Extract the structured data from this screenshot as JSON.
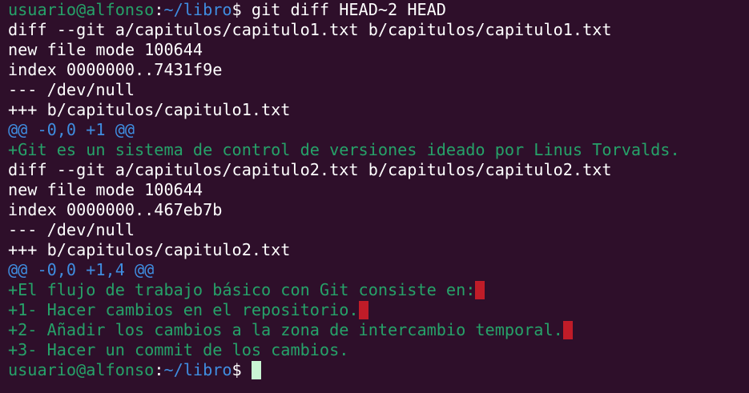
{
  "prompt": {
    "user_host": "usuario@alfonso",
    "separator": ":",
    "path": "~/libro",
    "symbol": "$ "
  },
  "command": "git diff HEAD~2 HEAD",
  "diff1": {
    "header": "diff --git a/capitulos/capitulo1.txt b/capitulos/capitulo1.txt",
    "mode": "new file mode 100644",
    "index": "index 0000000..7431f9e",
    "from": "--- /dev/null",
    "to": "+++ b/capitulos/capitulo1.txt",
    "hunk": "@@ -0,0 +1 @@",
    "added": [
      "+Git es un sistema de control de versiones ideado por Linus Torvalds."
    ]
  },
  "diff2": {
    "header": "diff --git a/capitulos/capitulo2.txt b/capitulos/capitulo2.txt",
    "mode": "new file mode 100644",
    "index": "index 0000000..467eb7b",
    "from": "--- /dev/null",
    "to": "+++ b/capitulos/capitulo2.txt",
    "hunk": "@@ -0,0 +1,4 @@",
    "added": [
      "+El flujo de trabajo básico con Git consiste en:",
      "+1- Hacer cambios en el repositorio.",
      "+2- Añadir los cambios a la zona de intercambio temporal.",
      "+3- Hacer un commit de los cambios."
    ]
  },
  "colors": {
    "background": "#2e0f2a",
    "text": "#ffffff",
    "prompt_user": "#26a269",
    "prompt_path": "#3f8de0",
    "hunk": "#3f8de0",
    "added": "#26a269",
    "trailing_whitespace": "#c01c28",
    "cursor": "#c9f5d4"
  }
}
